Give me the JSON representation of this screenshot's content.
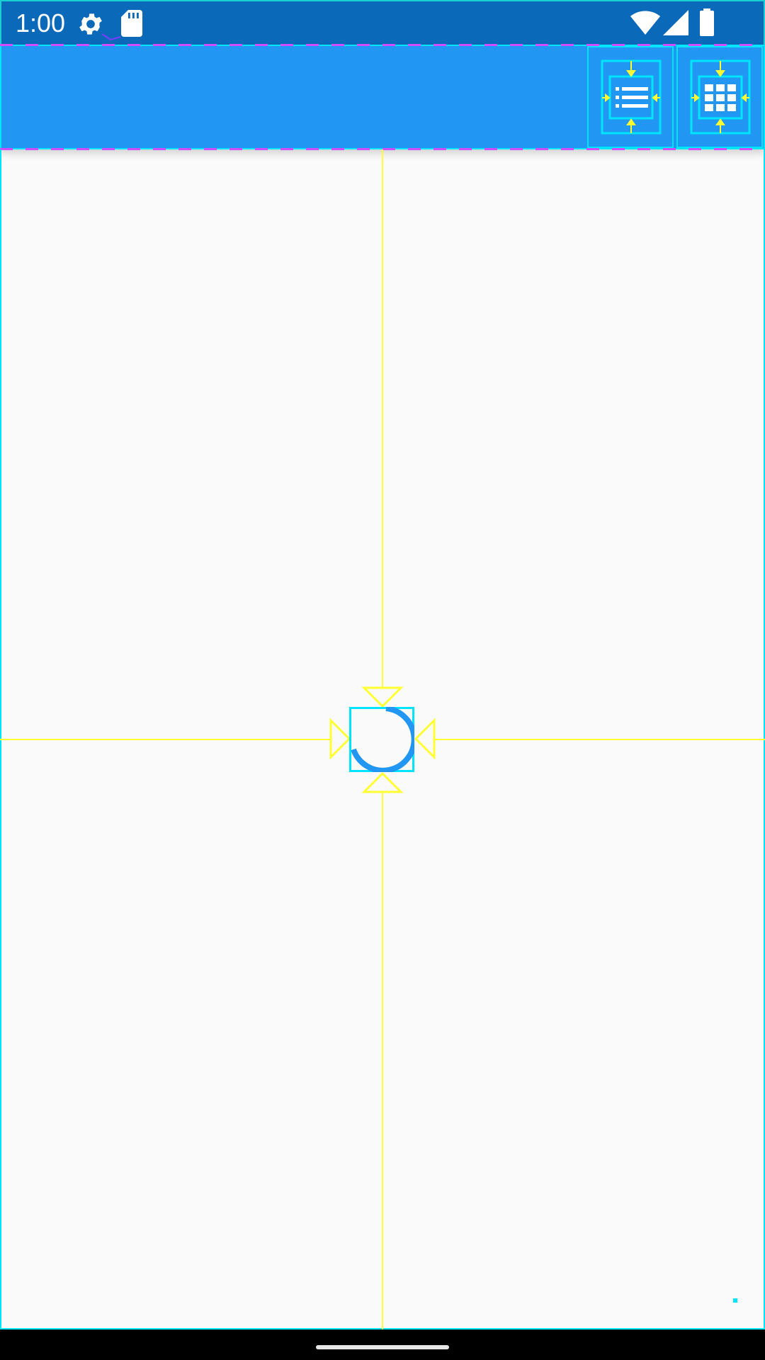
{
  "status_bar": {
    "time": "1:00",
    "left_icons": [
      "gear-icon",
      "sd-card-icon"
    ],
    "right_icons": [
      "wifi-icon",
      "cellular-signal-icon",
      "battery-icon"
    ]
  },
  "app_bar": {
    "title": "",
    "actions": [
      {
        "name": "list-view-button",
        "icon": "list-icon"
      },
      {
        "name": "grid-view-button",
        "icon": "grid-icon"
      }
    ],
    "color": "#2196f3"
  },
  "content": {
    "state": "loading",
    "indicator": "circular-progress-icon"
  },
  "colors": {
    "status_bar": "#0a6ab9",
    "accent": "#2196f3",
    "layout_bounds": "#00e5ff",
    "layout_guides": "#ffff33",
    "margins": "#d04dff"
  }
}
